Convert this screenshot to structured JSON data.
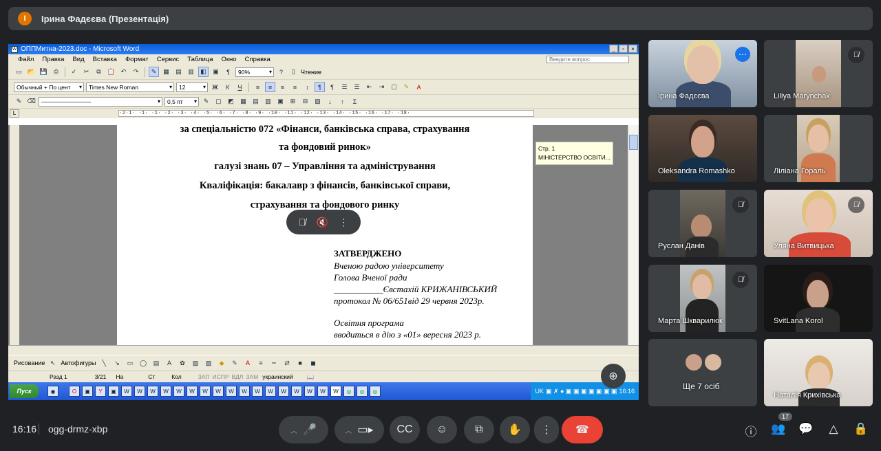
{
  "topbar": {
    "initial": "І",
    "title": "Ірина Фадєєва (Презентація)"
  },
  "word": {
    "window_title": "ОППМитна-2023.doc - Microsoft Word",
    "menu": [
      "Файл",
      "Правка",
      "Вид",
      "Вставка",
      "Формат",
      "Сервис",
      "Таблица",
      "Окно",
      "Справка"
    ],
    "ask_placeholder": "Введите вопрос",
    "zoom": "90%",
    "read_label": "Чтение",
    "style": "Обычный + По цент",
    "font": "Times New Roman",
    "size": "12",
    "line_width": "0,5 пт",
    "ruler_marks": "·2·1·  ·1·  ·1·  ·2·  ·3·  ·4·  ·5·  ·6·  ·7·  ·8·  ·9·  ·10·  ·11·  ·12·  ·13·  ·14·  ·15·  ·16·  ·17·  ·18·",
    "doc_lines": [
      "за спеціальністю  072 «Фінанси, банківська справа, страхування",
      "та фондовий ринок»",
      "галузі знань 07 – Управління та адміністрування",
      "Кваліфікація: бакалавр з фінансів, банківської справи,",
      "страхування та фондового ринку"
    ],
    "approval": {
      "heading": "ЗАТВЕРДЖЕНО",
      "l1": "Вченою радою університету",
      "l2": "Голова Вченої ради",
      "l3": "___________Євстахій КРИЖАНІВСЬКИЙ",
      "l4": "протокол № 06/651від 29 червня   2023р.",
      "l5": "Освітня програма",
      "l6": "вводиться в дію з «01» вересня  2023 р."
    },
    "comment": {
      "line1": "Стр. 1",
      "line2": "МІНІСТЕРСТВО ОСВІТИ..."
    },
    "draw_label": "Рисование",
    "autoshapes_label": "Автофигуры",
    "status": {
      "section": "Разд  1",
      "pages": "3/21",
      "at": "На",
      "line": "Ст",
      "col": "Кол",
      "rec": "ЗАП",
      "trk": "ИСПР",
      "ext": "ВДЛ",
      "ovr": "ЗАМ",
      "lang": "украинский"
    },
    "taskbar": {
      "start": "Пуск",
      "lang": "UK",
      "time": "16:16"
    }
  },
  "participants": [
    {
      "name": "Ірина Фадєєва",
      "muted": false
    },
    {
      "name": "Liliya Marynchak",
      "muted": true
    },
    {
      "name": "Oleksandra Romashko",
      "muted": false
    },
    {
      "name": "Ліліана Гораль",
      "muted": false
    },
    {
      "name": "Руслан Данів",
      "muted": true
    },
    {
      "name": "Уляна Витвицька",
      "muted": true
    },
    {
      "name": "Марта Шкварилюк",
      "muted": true
    },
    {
      "name": "SvitLana Korol",
      "muted": false
    },
    {
      "name": "Ще 7 осіб",
      "muted": false
    },
    {
      "name": "Наталія Крихівська",
      "muted": false
    }
  ],
  "bottom": {
    "time": "16:16",
    "meeting_code": "ogg-drmz-xbp",
    "people_count": "17"
  },
  "colors": {
    "bg": "#202124",
    "tile": "#3c4043",
    "end_call": "#ea4335",
    "accent": "#8ab4f8",
    "presenter": "#e37400"
  }
}
